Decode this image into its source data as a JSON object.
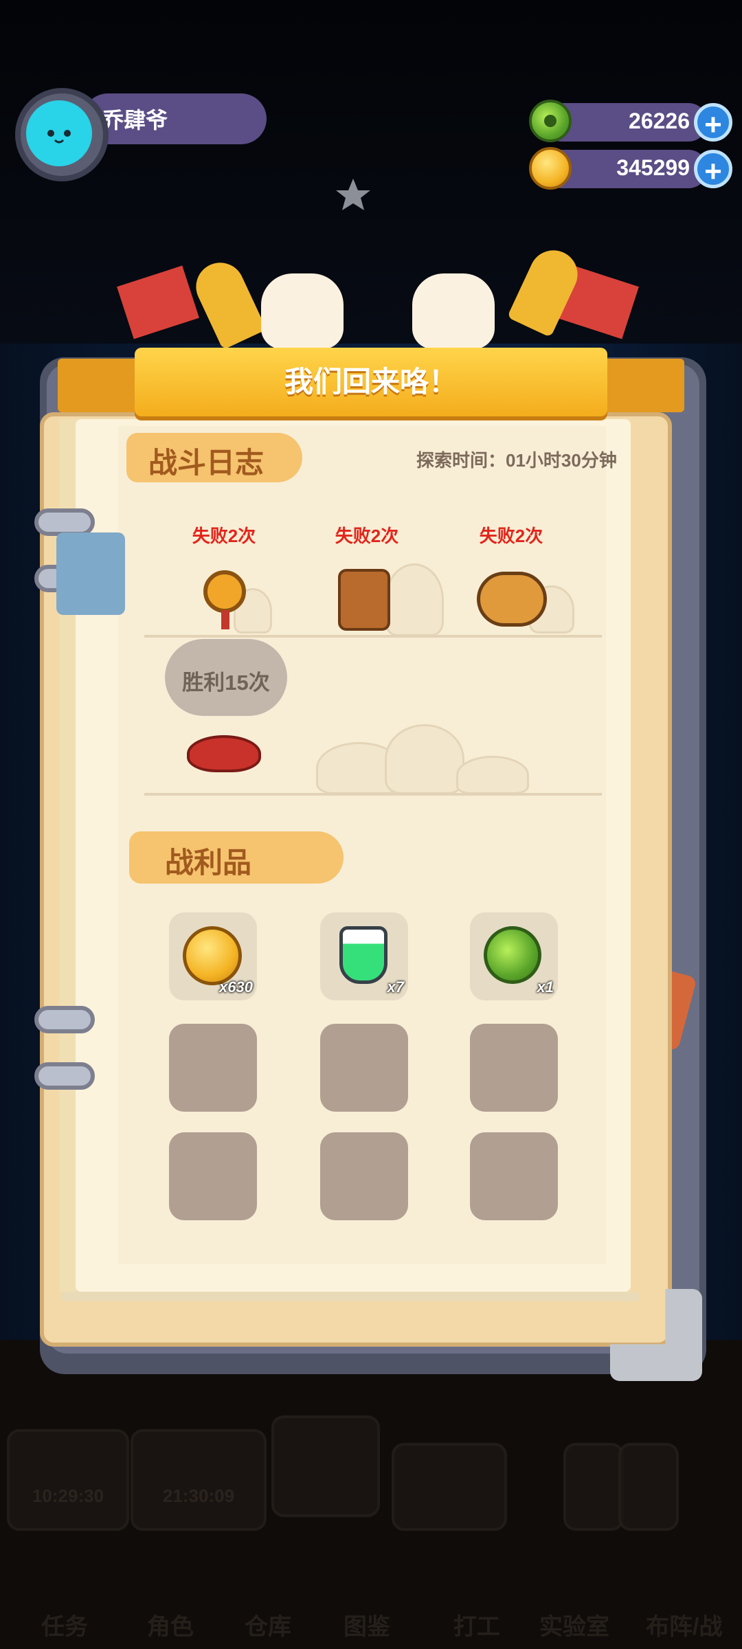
{
  "player": {
    "name": "乔肆爷"
  },
  "currencies": [
    {
      "icon": "green-donut-coin-icon",
      "value": "26226"
    },
    {
      "icon": "gold-planet-coin-icon",
      "value": "345299"
    }
  ],
  "panel": {
    "title": "我们回来咯！",
    "battle_log": {
      "heading": "战斗日志",
      "explore_time": "探索时间：01小时30分钟",
      "results": [
        {
          "label": "失败2次",
          "enemy": "key-monster-icon"
        },
        {
          "label": "失败2次",
          "enemy": "box-monster-icon"
        },
        {
          "label": "失败2次",
          "enemy": "pretzel-monster-icon"
        }
      ],
      "victory": {
        "label": "胜利15次",
        "enemy": "red-slime-icon"
      }
    },
    "loot": {
      "heading": "战利品",
      "items": [
        {
          "icon": "gold-coin-icon",
          "qty": "x630"
        },
        {
          "icon": "green-potion-icon",
          "qty": "x7"
        },
        {
          "icon": "green-donut-icon",
          "qty": "x1"
        }
      ],
      "empty_slots": 6
    }
  },
  "background_nav": {
    "timers": [
      "10:29:30",
      "21:30:09"
    ],
    "tabs": [
      "任务",
      "角色",
      "仓库",
      "图鉴",
      "打工",
      "实验室",
      "布阵/战"
    ]
  },
  "colors": {
    "accent": "#f4ad1d",
    "fail": "#e2251c",
    "pill": "#5b4d85",
    "plus": "#2d86e0"
  }
}
